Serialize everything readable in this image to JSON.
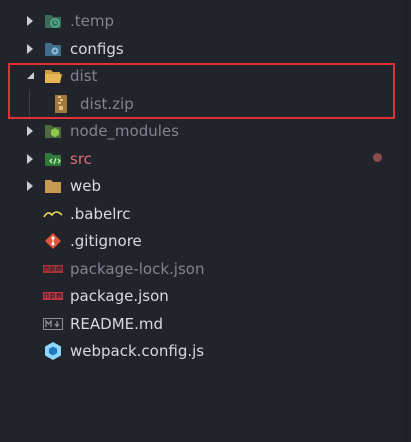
{
  "tree": {
    "items": [
      {
        "label": ".temp",
        "type": "folder",
        "expanded": false
      },
      {
        "label": "configs",
        "type": "folder",
        "expanded": false
      },
      {
        "label": "dist",
        "type": "folder",
        "expanded": true
      },
      {
        "label": "dist.zip",
        "type": "file"
      },
      {
        "label": "node_modules",
        "type": "folder",
        "expanded": false
      },
      {
        "label": "src",
        "type": "folder",
        "expanded": false
      },
      {
        "label": "web",
        "type": "folder",
        "expanded": false
      },
      {
        "label": ".babelrc",
        "type": "file"
      },
      {
        "label": ".gitignore",
        "type": "file"
      },
      {
        "label": "package-lock.json",
        "type": "file"
      },
      {
        "label": "package.json",
        "type": "file"
      },
      {
        "label": "README.md",
        "type": "file"
      },
      {
        "label": "webpack.config.js",
        "type": "file"
      }
    ]
  },
  "icons": {
    "temp": "timer-folder-icon",
    "configs": "gear-folder-icon",
    "dist": "open-folder-icon",
    "zip": "archive-icon",
    "node_modules": "nodejs-folder-icon",
    "src": "code-folder-icon",
    "web": "folder-icon",
    "babel": "babel-icon",
    "git": "git-icon",
    "npm": "npm-icon",
    "markdown": "markdown-icon",
    "webpack": "webpack-icon"
  },
  "colors": {
    "background": "#21252b",
    "text": "#d7dae0",
    "ignored_text": "#7f848e",
    "modified_text": "#e06c75",
    "highlight_border": "#e0303a"
  }
}
